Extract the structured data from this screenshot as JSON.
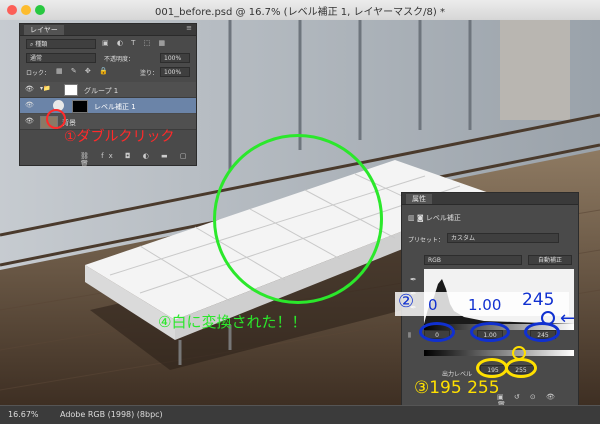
{
  "window": {
    "title": "001_before.psd @ 16.7% (レベル補正 1, レイヤーマスク/8) *"
  },
  "layers_panel": {
    "tab": "レイヤー",
    "filter_label": "種類",
    "blend_mode": "通常",
    "opacity_label": "不透明度：",
    "opacity_value": "100%",
    "lock_label": "ロック：",
    "fill_label": "塗り：",
    "fill_value": "100%",
    "layers": [
      {
        "name": "グループ 1"
      },
      {
        "name": "レベル補正 1"
      },
      {
        "name": "背景"
      }
    ]
  },
  "properties_panel": {
    "tab": "属性",
    "heading": "レベル補正",
    "preset_label": "プリセット：",
    "preset_value": "カスタム",
    "channel": "RGB",
    "auto_button": "自動補正",
    "input_black": "0",
    "input_gamma": "1.00",
    "input_white": "245",
    "output_label": "出力レベル",
    "output_black": "195",
    "output_white": "255"
  },
  "annotations": {
    "double_click": "①ダブルクリック",
    "step2_marker": "②",
    "step2_a": "0",
    "step2_b": "1.00",
    "step2_c": "245",
    "step3": "③195 255",
    "step4": "④白に変換された！！"
  },
  "statusbar": {
    "zoom": "16.67%",
    "profile": "Adobe RGB (1998) (8bpc)"
  },
  "colors": {
    "annotation_red": "#ff2a2a",
    "annotation_green": "#2be82b",
    "annotation_blue": "#1030d0",
    "annotation_yellow": "#ffe000",
    "panel_bg": "#4a4a4a"
  }
}
